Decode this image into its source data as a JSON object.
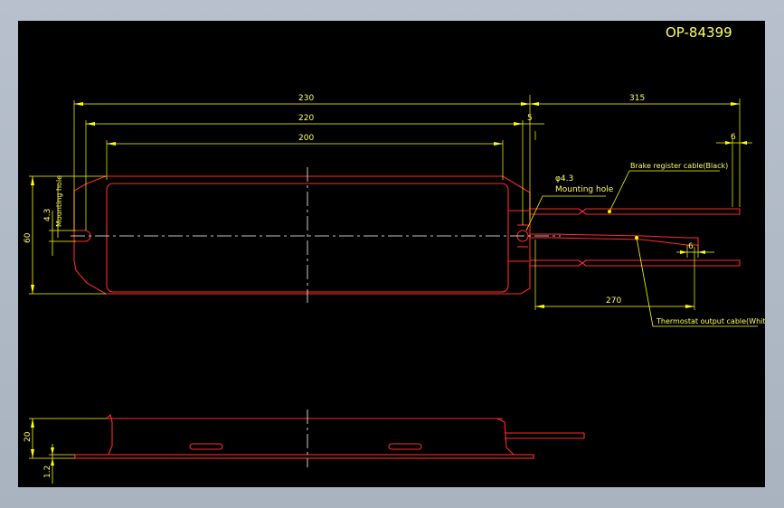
{
  "drawing": {
    "title_code": "OP-84399",
    "dims": {
      "d230": "230",
      "d220": "220",
      "d200": "200",
      "d315": "315",
      "d5": "5",
      "d6_top": "6",
      "d6_mid": "6",
      "d60": "60",
      "d43_left": "4.3",
      "d270": "270",
      "d20": "20",
      "d12": "1.2"
    },
    "labels": {
      "mounting_hole_left": "Mounting hole",
      "phi43": "φ4.3",
      "mounting_hole_right": "Mounting hole",
      "brake_cable": "Brake register cable(Black)",
      "thermostat_cable": "Thermostat output cable(White)"
    }
  },
  "colors": {
    "background": "#000000",
    "dimension": "#ffff00",
    "outline": "#ff2a2a",
    "centerline": "#ffffff",
    "frame": "#b7c0cc"
  }
}
